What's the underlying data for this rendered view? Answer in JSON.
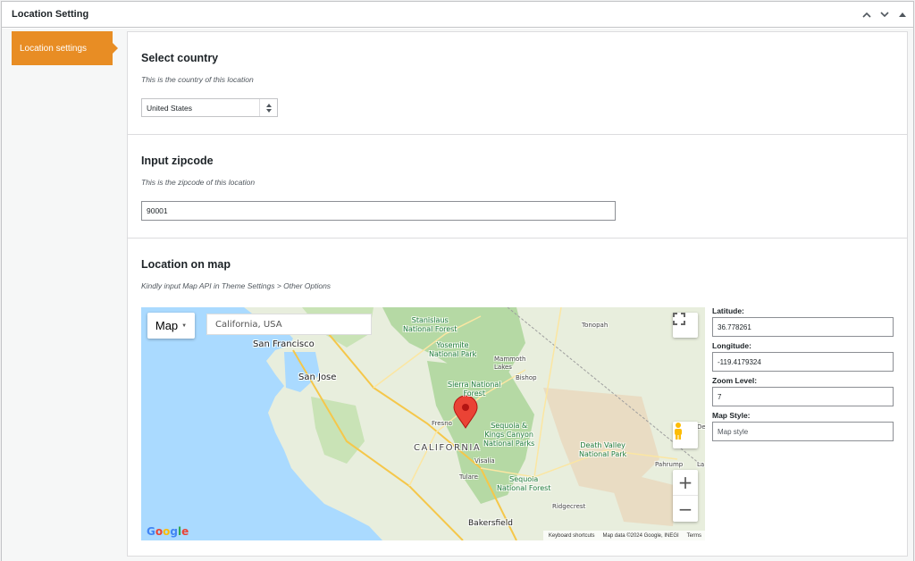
{
  "metabox": {
    "title": "Location Setting",
    "controls": [
      "chevron-up",
      "chevron-down",
      "triangle-up"
    ]
  },
  "tabs": [
    {
      "label": "Location settings",
      "active": true
    }
  ],
  "country_section": {
    "title": "Select country",
    "description": "This is the country of this location",
    "selected": "United States"
  },
  "zipcode_section": {
    "title": "Input zipcode",
    "description": "This is the zipcode of this location",
    "value": "90001"
  },
  "map_section": {
    "title": "Location on map",
    "description": "Kindly input Map API in Theme Settings > Other Options",
    "map": {
      "type_button": "Map",
      "search_value": "California, USA",
      "labels": {
        "san_francisco": "San Francisco",
        "san_jose": "San Jose",
        "stanislaus": "Stanislaus\nNational Forest",
        "yosemite": "Yosemite\nNational Park",
        "mammoth": "Mammoth\nLakes",
        "bishop": "Bishop",
        "sierra": "Sierra National\nForest",
        "tonopah": "Tonopah",
        "fresno": "Fresno",
        "california": "CALIFORNIA",
        "sequoia": "Sequoia &\nKings Canyon\nNational Parks",
        "death_valley": "Death Valley\nNational Park",
        "visalia": "Visalia",
        "tulare": "Tulare",
        "sequoia_forest": "Sequoia\nNational Forest",
        "pahrump": "Pahrump",
        "ridgecrest": "Ridgecrest",
        "bakersfield": "Bakersfield",
        "la": "La",
        "de": "De"
      },
      "google_logo": "Google",
      "attribution": {
        "shortcuts": "Keyboard shortcuts",
        "data": "Map data ©2024 Google, INEGI",
        "terms": "Terms"
      }
    },
    "fields": {
      "latitude_label": "Latitude:",
      "latitude_value": "36.778261",
      "longitude_label": "Longitude:",
      "longitude_value": "-119.4179324",
      "zoom_label": "Zoom Level:",
      "zoom_value": "7",
      "style_label": "Map Style:",
      "style_placeholder": "Map style"
    }
  },
  "colors": {
    "accent": "#e88d24",
    "water": "#aadaff",
    "land": "#e8eedd",
    "forest": "#b5d9a4",
    "desert": "#e9dcc3",
    "marker": "#ea4335"
  }
}
